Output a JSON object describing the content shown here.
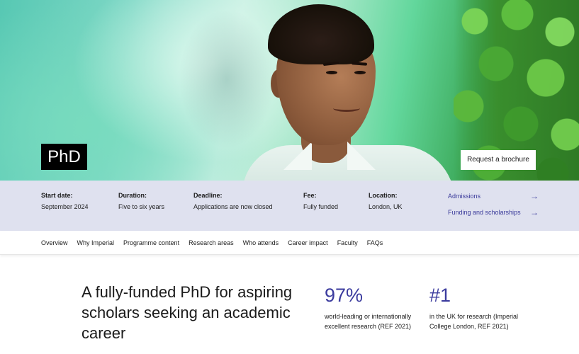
{
  "hero": {
    "badge": "PhD",
    "brochure_button": "Request a brochure"
  },
  "info": {
    "start": {
      "label": "Start date:",
      "value": "September 2024"
    },
    "duration": {
      "label": "Duration:",
      "value": "Five to six years"
    },
    "deadline": {
      "label": "Deadline:",
      "value": "Applications are now closed"
    },
    "fee": {
      "label": "Fee:",
      "value": "Fully funded"
    },
    "location": {
      "label": "Location:",
      "value": "London, UK"
    },
    "links": [
      {
        "label": "Admissions",
        "icon": "arrow-right-icon"
      },
      {
        "label": "Funding and scholarships",
        "icon": "arrow-right-icon"
      }
    ]
  },
  "nav": {
    "items": [
      "Overview",
      "Why Imperial",
      "Programme content",
      "Research areas",
      "Who attends",
      "Career impact",
      "Faculty",
      "FAQs"
    ]
  },
  "main": {
    "headline": "A fully-funded PhD for aspiring scholars seeking an academic career",
    "stats": [
      {
        "number": "97%",
        "description": "world-leading or internationally excellent research (REF 2021)"
      },
      {
        "number": "#1",
        "description": "in the UK for research (Imperial College London, REF 2021)"
      }
    ]
  },
  "colors": {
    "accent": "#3b3b9e",
    "info_bar_bg": "#dfe1ef"
  }
}
